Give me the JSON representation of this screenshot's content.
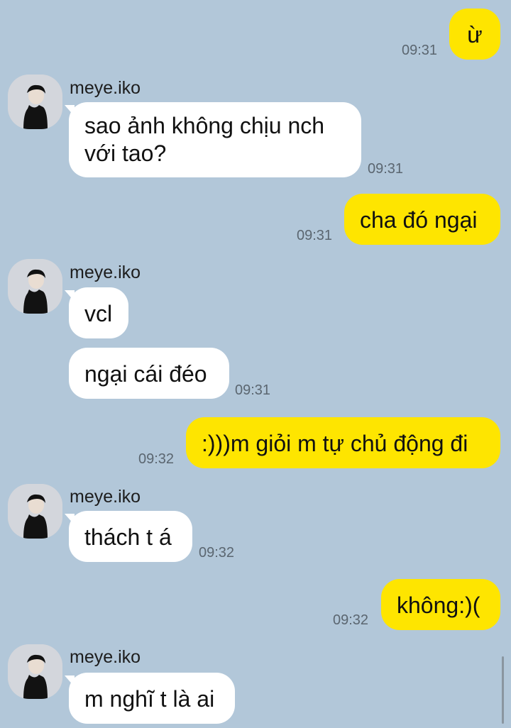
{
  "contact_name": "meye.iko",
  "messages": [
    {
      "from": "me",
      "text": "ừ",
      "time": "09:31"
    },
    {
      "from": "them",
      "text": "sao ảnh không chịu nch với tao?",
      "time": "09:31"
    },
    {
      "from": "me",
      "text": "cha đó ngại",
      "time": "09:31"
    },
    {
      "from": "them",
      "text": "vcl",
      "time": ""
    },
    {
      "from": "them",
      "text": "ngại cái đéo",
      "time": "09:31"
    },
    {
      "from": "me",
      "text": ":)))m giỏi m tự chủ động đi",
      "time": "09:32"
    },
    {
      "from": "them",
      "text": "thách t á",
      "time": "09:32"
    },
    {
      "from": "me",
      "text": "không:)(",
      "time": "09:32"
    },
    {
      "from": "them",
      "text": "m nghĩ t là ai",
      "time": ""
    }
  ],
  "icons": {
    "avatar": "person-avatar-icon"
  }
}
